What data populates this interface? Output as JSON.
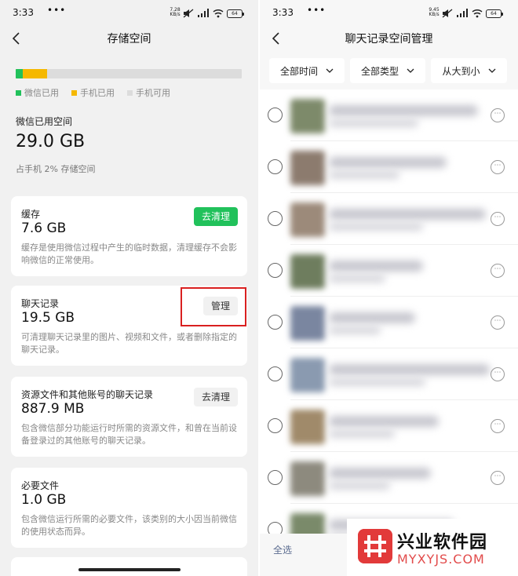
{
  "left": {
    "status": {
      "time": "3:33",
      "dots": "•••",
      "net_top": "7.28",
      "net_bottom": "KB/s",
      "battery": "64"
    },
    "nav": {
      "title": "存储空间"
    },
    "storage_bar": {
      "wechat_used_fraction": 0.03,
      "phone_used_fraction": 0.14
    },
    "legend": [
      {
        "label": "微信已用",
        "color": "#21c15b"
      },
      {
        "label": "手机已用",
        "color": "#f5b800"
      },
      {
        "label": "手机可用",
        "color": "#dcdcdc"
      }
    ],
    "summary": {
      "label": "微信已用空间",
      "value": "29.0 GB",
      "percent_text": "占手机 2% 存储空间"
    },
    "cards": [
      {
        "title": "缓存",
        "size": "7.6 GB",
        "desc": "缓存是使用微信过程中产生的临时数据，清理缓存不会影响微信的正常使用。",
        "button": "去清理"
      },
      {
        "title": "聊天记录",
        "size": "19.5 GB",
        "desc": "可清理聊天记录里的图片、视频和文件，或者删除指定的聊天记录。",
        "button": "管理"
      },
      {
        "title": "资源文件和其他账号的聊天记录",
        "size": "887.9 MB",
        "desc": "包含微信部分功能运行时所需的资源文件，和曾在当前设备登录过的其他账号的聊天记录。",
        "button": "去清理"
      },
      {
        "title": "必要文件",
        "size": "1.0 GB",
        "desc": "包含微信运行所需的必要文件，该类别的大小因当前微信的使用状态而异。"
      }
    ]
  },
  "right": {
    "status": {
      "time": "3:33",
      "dots": "•••",
      "net_top": "9.45",
      "net_bottom": "KB/s",
      "battery": "64"
    },
    "nav": {
      "title": "聊天记录空间管理"
    },
    "filters": [
      {
        "label": "全部时间"
      },
      {
        "label": "全部类型"
      },
      {
        "label": "从大到小"
      }
    ],
    "more_icon": "⋯",
    "bottom": {
      "select_all": "全选"
    }
  },
  "watermark": {
    "name": "兴业软件园",
    "url": "MYXYJS.COM"
  }
}
